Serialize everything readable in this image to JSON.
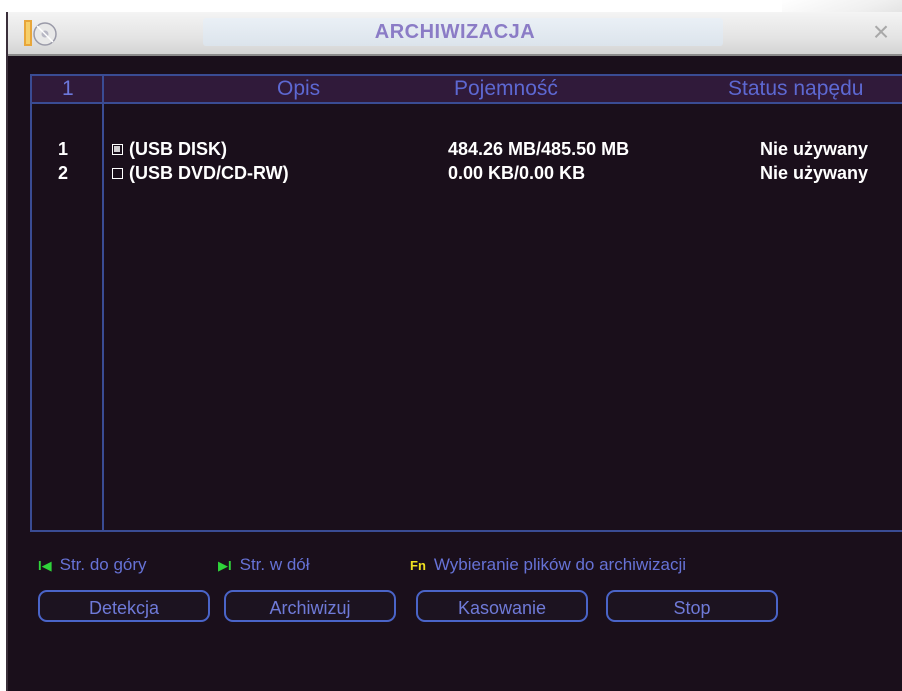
{
  "window": {
    "title": "ARCHIWIZACJA"
  },
  "table": {
    "headers": {
      "index": "1",
      "description": "Opis",
      "capacity": "Pojemność",
      "status": "Status napędu"
    },
    "rows": [
      {
        "index": "1",
        "checked": true,
        "description": "(USB DISK)",
        "capacity": "484.26 MB/485.50 MB",
        "status": "Nie używany"
      },
      {
        "index": "2",
        "checked": false,
        "description": "(USB DVD/CD-RW)",
        "capacity": "0.00 KB/0.00 KB",
        "status": "Nie używany"
      }
    ]
  },
  "hints": {
    "page_up_key": "I◀",
    "page_up": "Str. do góry",
    "page_down_key": "▶I",
    "page_down": "Str. w dół",
    "fn_key": "Fn",
    "fn": "Wybieranie plików do archiwizacji"
  },
  "buttons": {
    "detect": "Detekcja",
    "archive": "Archiwizuj",
    "erase": "Kasowanie",
    "stop": "Stop"
  },
  "icons": {
    "app": "dvr-app-icon",
    "close": "close-icon",
    "page_up": "page-up-icon",
    "page_down": "page-down-icon",
    "fn": "fn-key-icon"
  },
  "colors": {
    "background": "#1a0f1b",
    "header_text": "#5d68d2",
    "row_text": "#ffffff",
    "border": "#3a4c94",
    "title_text": "#8b7cc6",
    "hint_key_green": "#2fd33a",
    "hint_key_yellow": "#f0e020"
  }
}
